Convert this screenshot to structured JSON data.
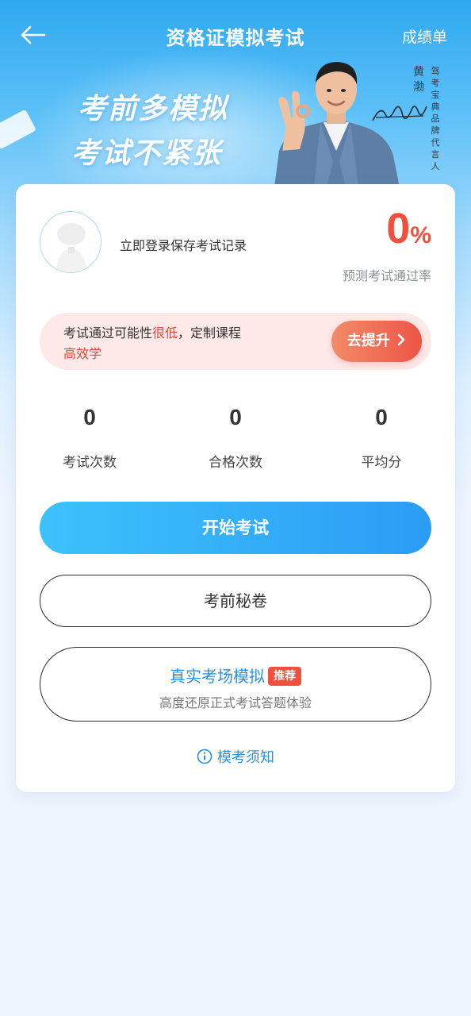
{
  "header": {
    "title": "资格证模拟考试",
    "right_link": "成绩单"
  },
  "banner": {
    "slogan_line1": "考前多模拟",
    "slogan_line2": "考试不紧张",
    "endorser_name": "黄渤",
    "endorser_role": "驾考宝典品牌代言人"
  },
  "profile": {
    "login_prompt": "立即登录保存考试记录",
    "pass_rate_value": "0",
    "pass_rate_unit": "%",
    "pass_rate_label": "预测考试通过率"
  },
  "promo": {
    "text_prefix": "考试通过可能性",
    "text_highlight": "很低",
    "text_suffix": "，定制课程",
    "text_line2": "高效学",
    "button_label": "去提升"
  },
  "stats": [
    {
      "value": "0",
      "label": "考试次数"
    },
    {
      "value": "0",
      "label": "合格次数"
    },
    {
      "value": "0",
      "label": "平均分"
    }
  ],
  "actions": {
    "start_exam": "开始考试",
    "secret_paper": "考前秘卷",
    "real_sim_title": "真实考场模拟",
    "real_sim_badge": "推荐",
    "real_sim_desc": "高度还原正式考试答题体验",
    "notice": "模考须知"
  },
  "colors": {
    "accent_blue": "#2c9cf5",
    "accent_red": "#f0503e",
    "link_blue": "#2b8fdc"
  }
}
